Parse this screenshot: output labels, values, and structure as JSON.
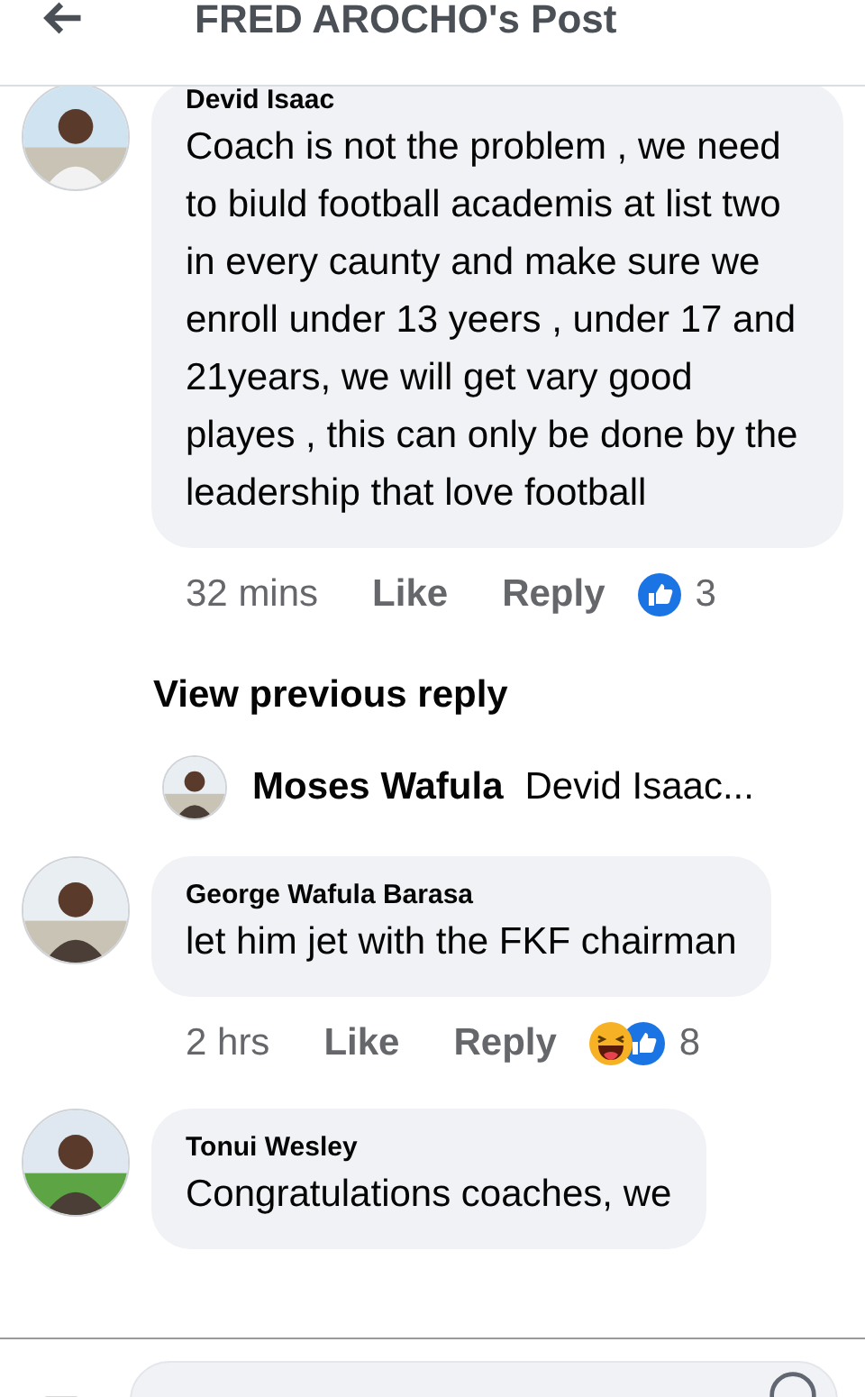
{
  "header": {
    "title": "FRED AROCHO's Post"
  },
  "comments": [
    {
      "author": "Devid Isaac",
      "text": "Coach is not the problem ,  we need to biuld football academis at list  two in every caunty and make sure we enroll under 13 yeers , under 17  and 21years, we will get vary good playes , this can only be done by the leadership that love football",
      "time": "32 mins",
      "like": "Like",
      "reply": "Reply",
      "reactions": [
        {
          "kind": "like"
        }
      ],
      "reaction_count": "3",
      "view_previous": "View previous reply",
      "reply_preview": {
        "author": "Moses Wafula",
        "text": "Devid Isaac..."
      }
    },
    {
      "author": "George Wafula Barasa",
      "text": "let him jet with the FKF chairman",
      "time": "2 hrs",
      "like": "Like",
      "reply": "Reply",
      "reactions": [
        {
          "kind": "haha"
        },
        {
          "kind": "like"
        }
      ],
      "reaction_count": "8"
    },
    {
      "author": "Tonui Wesley",
      "text": "Congratulations coaches, we"
    }
  ]
}
